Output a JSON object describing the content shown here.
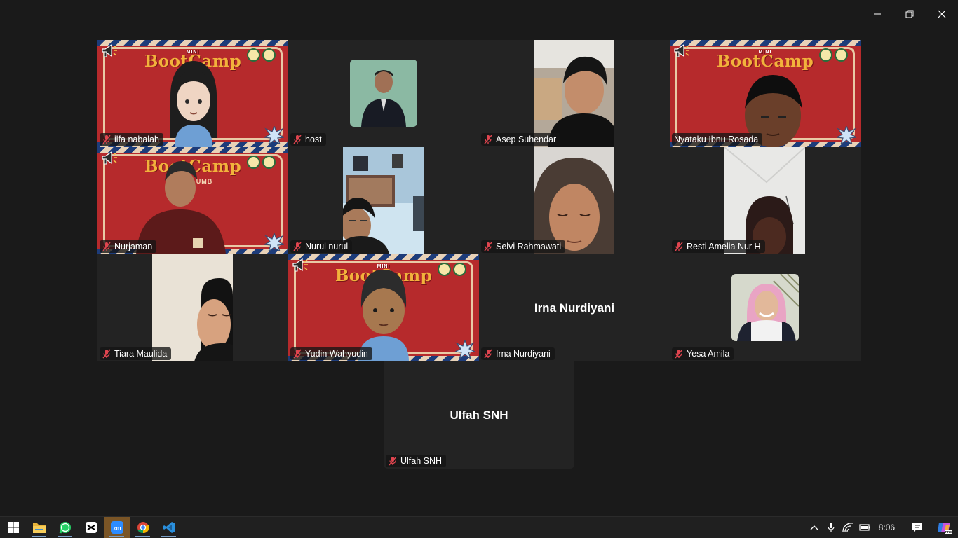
{
  "window": {
    "minimize_icon": "minimize-icon",
    "restore_icon": "restore-icon",
    "close_icon": "close-icon"
  },
  "background": {
    "brand_small": "MINI",
    "brand": "BootCamp",
    "brand_sub": "HIMIF UMB"
  },
  "participants": [
    {
      "name": "ilfa nabalah",
      "muted": true,
      "video": "avatar-bootcamp",
      "active_speaker": false
    },
    {
      "name": "host",
      "muted": true,
      "video": "profile-photo",
      "active_speaker": false
    },
    {
      "name": "Asep Suhendar",
      "muted": true,
      "video": "camera",
      "active_speaker": false
    },
    {
      "name": "Nyataku Ibnu Rosada",
      "muted": false,
      "video": "camera-bootcamp",
      "active_speaker": true
    },
    {
      "name": "Nurjaman",
      "muted": true,
      "video": "camera-bootcamp",
      "active_speaker": false
    },
    {
      "name": "Nurul nurul",
      "muted": true,
      "video": "camera",
      "active_speaker": false
    },
    {
      "name": "Selvi Rahmawati",
      "muted": true,
      "video": "camera",
      "active_speaker": false
    },
    {
      "name": "Resti Amelia Nur H",
      "muted": true,
      "video": "camera",
      "active_speaker": false
    },
    {
      "name": "Tiara Maulida",
      "muted": true,
      "video": "camera",
      "active_speaker": false
    },
    {
      "name": "Yudin Wahyudin",
      "muted": true,
      "video": "avatar-bootcamp",
      "active_speaker": false
    },
    {
      "name": "Irna Nurdiyani",
      "muted": true,
      "video": "off",
      "active_speaker": false
    },
    {
      "name": "Yesa Amila",
      "muted": true,
      "video": "profile-photo",
      "active_speaker": false
    },
    {
      "name": "Ulfah SNH",
      "muted": true,
      "video": "off",
      "active_speaker": false
    }
  ],
  "taskbar": {
    "apps": [
      "windows-start-icon",
      "file-explorer-icon",
      "whatsapp-icon",
      "capcut-icon",
      "zoom-icon",
      "chrome-icon",
      "vscode-icon"
    ],
    "zoom_label": "zm",
    "clock": "8:06",
    "tray_icons": [
      "chevron-up-icon",
      "microphone-icon",
      "wifi-icon",
      "battery-icon",
      "notification-icon",
      "copilot-icon"
    ],
    "copilot_badge": "PRE"
  },
  "colors": {
    "active_speaker_border": "#23d18b",
    "muted_mic": "#e0454f",
    "tile_bg": "#232323",
    "background": "#1a1a1a"
  }
}
